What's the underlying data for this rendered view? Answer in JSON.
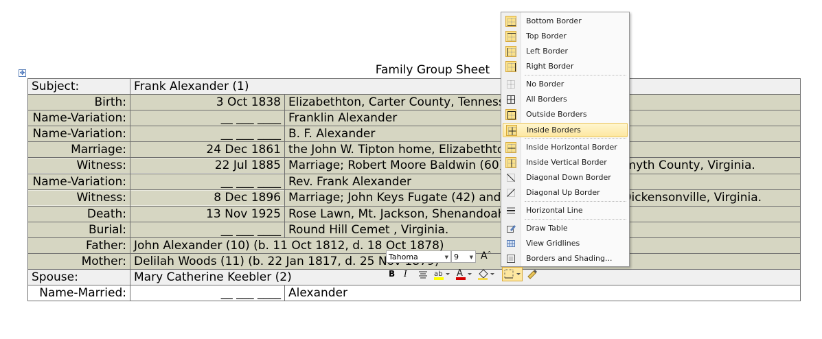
{
  "document": {
    "title": "Family Group Sheet",
    "rows": [
      {
        "label": "Subject:",
        "date": "",
        "place": "",
        "span": "Frank Alexander (1)",
        "style": "lg"
      },
      {
        "label": "Birth:",
        "date": "3 Oct 1838",
        "place": "Elizabethton, Carter County, Tenness",
        "style": "hl"
      },
      {
        "label": "Name-Variation:",
        "date": "__ ___ ____",
        "place": "Franklin Alexander",
        "style": "hl"
      },
      {
        "label": "Name-Variation:",
        "date": "__ ___ ____",
        "place": "B. F. Alexander",
        "style": "hl"
      },
      {
        "label": "Marriage:",
        "date": "24 Dec 1861",
        "place": "the John W. Tipton home, Elizabethto",
        "style": "hl"
      },
      {
        "label": "Witness:",
        "date": "22 Jul 1885",
        "place": "Marriage; Robert Moore Baldwin (60)                          xander (4); Union, Smyth County, Virginia.",
        "style": "hlw"
      },
      {
        "label": "Name-Variation:",
        "date": "__ ___ ____",
        "place": "Rev. Frank Alexander",
        "style": "hl"
      },
      {
        "label": "Witness:",
        "date": "8 Dec 1896",
        "place": "Marriage; John Keys Fugate (42) and                          (6); The Parsonage, Dickensonville, Virginia.",
        "style": "hlw"
      },
      {
        "label": "Death:",
        "date": "13 Nov 1925",
        "place": "Rose Lawn, Mt. Jackson, Shenandoah",
        "style": "hl"
      },
      {
        "label": "Burial:",
        "date": "__ ___ ____",
        "place": "Round Hill Cemet                          , Virginia.",
        "style": "hl"
      },
      {
        "label": "Father:",
        "date": "",
        "place": "",
        "span": "John Alexander (10) (b. 11 Oct 1812, d. 18 Oct 1878)",
        "style": "hl"
      },
      {
        "label": "Mother:",
        "date": "",
        "place": "",
        "span": "Delilah Woods (11) (b. 22 Jan 1817, d. 25 Nov 1879)",
        "style": "hl"
      },
      {
        "label": "Spouse:",
        "date": "",
        "place": "",
        "span": "Mary Catherine Keebler (2)",
        "style": "lg"
      },
      {
        "label": "Name-Married:",
        "date": "__ ___ ____",
        "place": "Alexander",
        "style": "plain"
      }
    ]
  },
  "border_menu": {
    "items": [
      {
        "label": "Bottom Border",
        "icon": "bottom-border-icon",
        "active": true
      },
      {
        "label": "Top Border",
        "icon": "top-border-icon",
        "active": true
      },
      {
        "label": "Left Border",
        "icon": "left-border-icon",
        "active": true
      },
      {
        "label": "Right Border",
        "icon": "right-border-icon",
        "active": true
      },
      {
        "label": "No Border",
        "icon": "no-border-icon",
        "active": false
      },
      {
        "label": "All Borders",
        "icon": "all-borders-icon",
        "active": false
      },
      {
        "label": "Outside Borders",
        "icon": "outside-borders-icon",
        "active": true
      },
      {
        "label": "Inside Borders",
        "icon": "inside-borders-icon",
        "active": true,
        "selected": true
      },
      {
        "label": "Inside Horizontal Border",
        "icon": "inside-horizontal-border-icon",
        "active": true
      },
      {
        "label": "Inside Vertical Border",
        "icon": "inside-vertical-border-icon",
        "active": true
      },
      {
        "label": "Diagonal Down Border",
        "icon": "diagonal-down-border-icon",
        "active": false
      },
      {
        "label": "Diagonal Up Border",
        "icon": "diagonal-up-border-icon",
        "active": false
      },
      {
        "label": "Horizontal Line",
        "icon": "horizontal-line-icon",
        "active": false
      },
      {
        "label": "Draw Table",
        "icon": "draw-table-icon",
        "active": false
      },
      {
        "label": "View Gridlines",
        "icon": "view-gridlines-icon",
        "active": false
      },
      {
        "label": "Borders and Shading...",
        "icon": "borders-and-shading-icon",
        "active": false
      }
    ]
  },
  "mini_toolbar": {
    "font": "Tahoma",
    "size": "9",
    "grow_font": "A",
    "bold": "B",
    "italic": "I",
    "font_color": "A"
  },
  "colors": {
    "row_highlight": "#d6d6c2",
    "header_row": "#f0f0f0",
    "menu_active_icon": "#fbe28a"
  }
}
